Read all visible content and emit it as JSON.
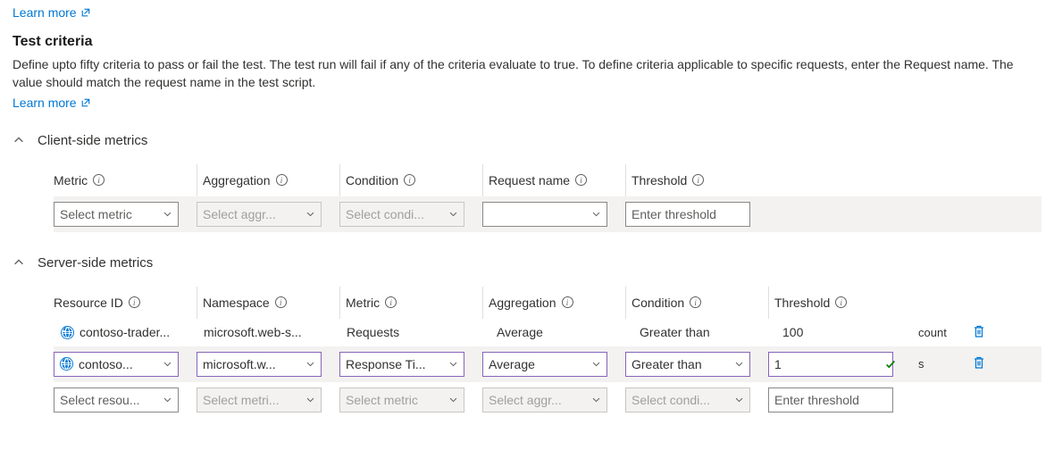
{
  "links": {
    "learn_more": "Learn more"
  },
  "section": {
    "title": "Test criteria",
    "description": "Define upto fifty criteria to pass or fail the test. The test run will fail if any of the criteria evaluate to true. To define criteria applicable to specific requests, enter the Request name. The value should match the request name in the test script."
  },
  "client": {
    "title": "Client-side metrics",
    "headers": {
      "metric": "Metric",
      "aggregation": "Aggregation",
      "condition": "Condition",
      "request_name": "Request name",
      "threshold": "Threshold"
    },
    "row": {
      "metric_placeholder": "Select metric",
      "aggregation_placeholder": "Select aggr...",
      "condition_placeholder": "Select condi...",
      "request_value": "",
      "threshold_placeholder": "Enter threshold"
    }
  },
  "server": {
    "title": "Server-side metrics",
    "headers": {
      "resource_id": "Resource ID",
      "namespace": "Namespace",
      "metric": "Metric",
      "aggregation": "Aggregation",
      "condition": "Condition",
      "threshold": "Threshold"
    },
    "rows": [
      {
        "resource": "contoso-trader...",
        "namespace": "microsoft.web-s...",
        "metric": "Requests",
        "aggregation": "Average",
        "condition": "Greater than",
        "threshold": "100",
        "unit": "count"
      },
      {
        "resource": "contoso...",
        "namespace": "microsoft.w...",
        "metric": "Response Ti...",
        "aggregation": "Average",
        "condition": "Greater than",
        "threshold": "1",
        "unit": "s"
      },
      {
        "resource_placeholder": "Select resou...",
        "namespace_placeholder": "Select metri...",
        "metric_placeholder": "Select metric",
        "aggregation_placeholder": "Select aggr...",
        "condition_placeholder": "Select condi...",
        "threshold_placeholder": "Enter threshold"
      }
    ]
  }
}
